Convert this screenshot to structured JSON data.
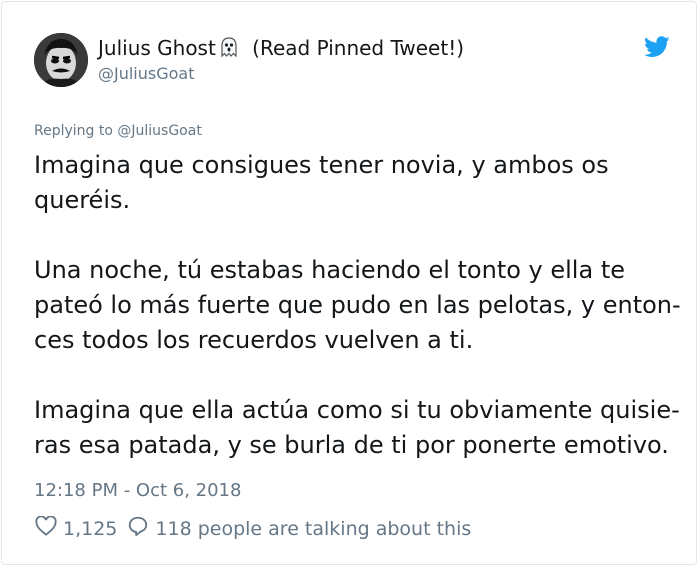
{
  "tweet": {
    "display_name": "Julius Ghost",
    "name_suffix": "(Read Pinned Tweet!)",
    "handle": "@JuliusGoat",
    "replying_to": "Replying to @JuliusGoat",
    "paragraphs": [
      "Imagina que consigues tener novia, y ambos os queréis.",
      "Una noche, tú estabas haciendo el tonto y ella te pateó lo más fuerte que pudo en las pelotas, y enton-ces todos los recuerdos vuelven a ti.",
      "Imagina que ella actúa como si tu obviamente quisie-ras esa patada, y se burla de ti por ponerte emotivo."
    ],
    "timestamp": "12:18 PM - Oct 6, 2018",
    "likes": "1,125",
    "replies_text": "118 people are talking about this"
  },
  "icons": {
    "name_emoji": "ghost-icon",
    "brand": "twitter-bird-icon",
    "like": "heart-icon",
    "reply": "reply-bubble-icon"
  },
  "colors": {
    "text": "#14171a",
    "secondary": "#657786",
    "brand_blue": "#1da1f2",
    "border": "#e1e8ed"
  }
}
